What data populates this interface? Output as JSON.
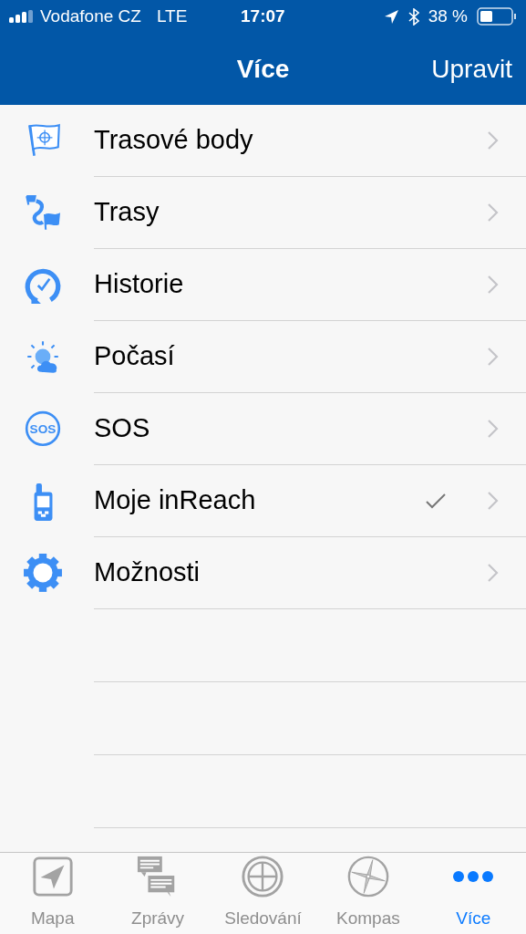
{
  "status_bar": {
    "carrier": "Vodafone CZ",
    "network": "LTE",
    "time": "17:07",
    "battery": "38 %"
  },
  "nav_bar": {
    "title": "Více",
    "action": "Upravit"
  },
  "menu": [
    {
      "kind": "waypoint",
      "label": "Trasové body",
      "checked": false
    },
    {
      "kind": "route",
      "label": "Trasy",
      "checked": false
    },
    {
      "kind": "history",
      "label": "Historie",
      "checked": false
    },
    {
      "kind": "weather",
      "label": "Počasí",
      "checked": false
    },
    {
      "kind": "sos",
      "label": "SOS",
      "checked": false,
      "icon_text": "SOS"
    },
    {
      "kind": "device",
      "label": "Moje inReach",
      "checked": true
    },
    {
      "kind": "settings",
      "label": "Možnosti",
      "checked": false
    }
  ],
  "tab_bar": [
    {
      "kind": "map",
      "label": "Mapa",
      "selected": false
    },
    {
      "kind": "messages",
      "label": "Zprávy",
      "selected": false
    },
    {
      "kind": "tracking",
      "label": "Sledování",
      "selected": false
    },
    {
      "kind": "compass",
      "label": "Kompas",
      "selected": false
    },
    {
      "kind": "more",
      "label": "Více",
      "selected": true
    }
  ]
}
